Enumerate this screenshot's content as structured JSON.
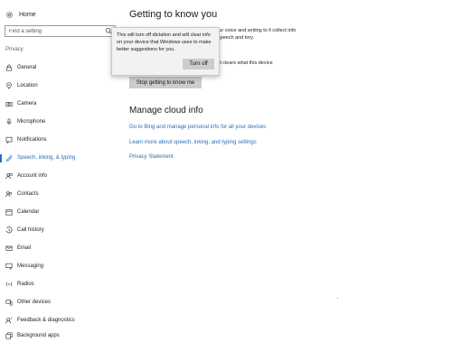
{
  "sidebar": {
    "home_label": "Home",
    "search_placeholder": "Find a setting",
    "section_label": "Privacy",
    "items": [
      {
        "label": "General",
        "icon": "lock-icon"
      },
      {
        "label": "Location",
        "icon": "location-icon"
      },
      {
        "label": "Camera",
        "icon": "camera-icon"
      },
      {
        "label": "Microphone",
        "icon": "microphone-icon"
      },
      {
        "label": "Notifications",
        "icon": "notifications-icon"
      },
      {
        "label": "Speech, inking, & typing",
        "icon": "speech-icon",
        "active": true
      },
      {
        "label": "Account info",
        "icon": "account-icon"
      },
      {
        "label": "Contacts",
        "icon": "contacts-icon"
      },
      {
        "label": "Calendar",
        "icon": "calendar-icon"
      },
      {
        "label": "Call history",
        "icon": "call-history-icon"
      },
      {
        "label": "Email",
        "icon": "email-icon"
      },
      {
        "label": "Messaging",
        "icon": "messaging-icon"
      },
      {
        "label": "Radios",
        "icon": "radios-icon"
      },
      {
        "label": "Other devices",
        "icon": "other-devices-icon"
      },
      {
        "label": "Feedback & diagnostics",
        "icon": "feedback-icon"
      },
      {
        "label": "Background apps",
        "icon": "background-apps-icon"
      }
    ]
  },
  "main": {
    "title": "Getting to know you",
    "intro_text": "w your voice and writing to ll collect info like speech and tory.",
    "intro_text_2": "n and clears what this device",
    "stop_button_label": "Stop getting to know me",
    "cloud_heading": "Manage cloud info",
    "links": [
      "Go to Bing and manage personal info for all your devices",
      "Learn more about speech, inking, and typing settings",
      "Privacy Statement"
    ]
  },
  "popup": {
    "message": "This will turn off dictation and will clear info on your device that Windows uses to make better suggestions for you.",
    "button_label": "Turn off"
  },
  "colors": {
    "accent": "#2a6fb9",
    "button": "#cccccc",
    "popup_bg": "#f2f2f2"
  }
}
